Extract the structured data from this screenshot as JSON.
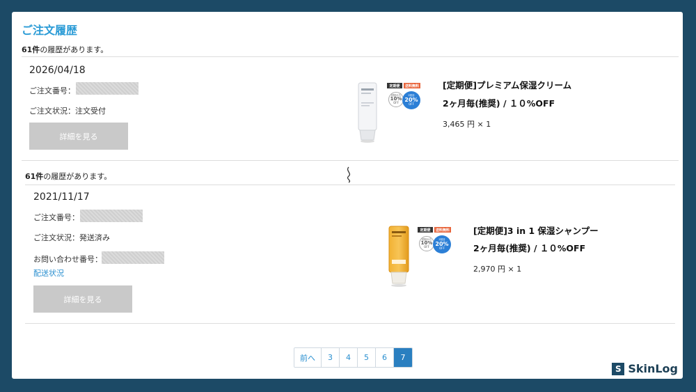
{
  "page": {
    "title": "ご注文履歴"
  },
  "count": {
    "number": "61件",
    "suffix": "の履歴があります。"
  },
  "orders": [
    {
      "date": "2026/04/18",
      "order_number_label": "ご注文番号：",
      "status_label": "ご注文状況：注文受付",
      "detail_button": "詳細を見る",
      "product": {
        "title": "[定期便]プレミアム保湿クリーム",
        "subtitle": "2ヶ月毎(推奨) / １０%OFF",
        "price": "3,465 円 × 1"
      }
    },
    {
      "date": "2021/11/17",
      "order_number_label": "ご注文番号：",
      "status_label": "ご注文状況：発送済み",
      "tracking_label": "お問い合わせ番号：",
      "shipping_link": "配送状況",
      "detail_button": "詳細を見る",
      "product": {
        "title": "[定期便]3 in 1 保湿シャンプー",
        "subtitle": "2ヶ月毎(推奨) / １０%OFF",
        "price": "2,970 円 × 1"
      }
    }
  ],
  "badges": {
    "tag_left": "定期便",
    "tag_right": "送料無料",
    "circle1_small": "初回から",
    "circle1_big": "10%",
    "circle1_off": "OFF",
    "circle2_small": "2回目",
    "circle2_big": "20%",
    "circle2_off": "OFF"
  },
  "pagination": {
    "prev": "前へ",
    "pages": [
      "3",
      "4",
      "5",
      "6",
      "7"
    ],
    "active": "7"
  },
  "logo": {
    "mark": "S",
    "text": "SkinLog"
  },
  "colors": {
    "background": "#1c4a66",
    "title": "#2a9bd6",
    "link": "#2a8fd0",
    "active_page": "#2a7fc0",
    "button_disabled": "#c9c9c9"
  }
}
